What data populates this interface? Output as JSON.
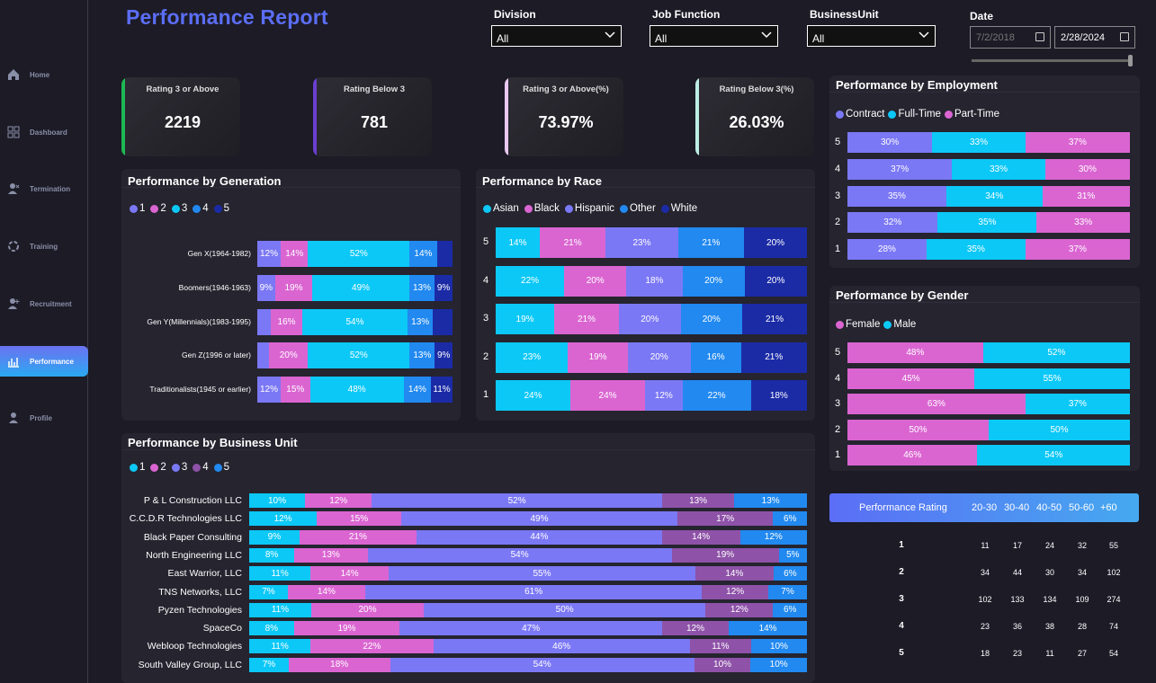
{
  "title": "Performance Report",
  "nav": [
    {
      "label": "Home",
      "icon": "home-icon",
      "active": false
    },
    {
      "label": "Dashboard",
      "icon": "dashboard-icon",
      "active": false
    },
    {
      "label": "Termination",
      "icon": "user-remove-icon",
      "active": false
    },
    {
      "label": "Training",
      "icon": "training-icon",
      "active": false
    },
    {
      "label": "Recruitment",
      "icon": "user-add-icon",
      "active": false
    },
    {
      "label": "Performance",
      "icon": "performance-chart-icon",
      "active": true
    },
    {
      "label": "Profile",
      "icon": "profile-icon",
      "active": false
    }
  ],
  "filters": {
    "division": {
      "label": "Division",
      "value": "All"
    },
    "job_function": {
      "label": "Job Function",
      "value": "All"
    },
    "business_unit": {
      "label": "BusinessUnit",
      "value": "All"
    },
    "date": {
      "label": "Date",
      "start": "7/2/2018",
      "end": "2/28/2024"
    }
  },
  "kpis": [
    {
      "title": "Rating 3 or Above",
      "value": "2219",
      "color": "#1db954"
    },
    {
      "title": "Rating Below 3",
      "value": "781",
      "color": "#6a3fd1"
    },
    {
      "title": "Rating 3 or Above(%)",
      "value": "73.97%",
      "color": "#e8c8f0"
    },
    {
      "title": "Rating Below 3(%)",
      "value": "26.03%",
      "color": "#bdeee4"
    }
  ],
  "colors": {
    "c1": "#7b78f5",
    "c2": "#da65d1",
    "c3": "#0cc8f7",
    "c4": "#2189f0",
    "c5": "#1b2ba6",
    "purple": "#8e52a8"
  },
  "generation": {
    "title": "Performance by Generation",
    "legend": [
      "1",
      "2",
      "3",
      "4",
      "5"
    ],
    "rows": [
      {
        "label": "Gen X(1964-1982)",
        "values": [
          12,
          14,
          52,
          14,
          8
        ],
        "labels": [
          "12%",
          "14%",
          "52%",
          "14%",
          ""
        ]
      },
      {
        "label": "Boomers(1946-1963)",
        "values": [
          9,
          19,
          49,
          13,
          9
        ],
        "labels": [
          "9%",
          "19%",
          "49%",
          "13%",
          "9%"
        ]
      },
      {
        "label": "Gen Y(Millennials)(1983-1995)",
        "values": [
          7,
          16,
          54,
          13,
          10
        ],
        "labels": [
          "",
          "16%",
          "54%",
          "13%",
          ""
        ]
      },
      {
        "label": "Gen Z(1996 or later)",
        "values": [
          6,
          20,
          52,
          13,
          9
        ],
        "labels": [
          "",
          "20%",
          "52%",
          "13%",
          "9%"
        ]
      },
      {
        "label": "Traditionalists(1945 or earlier)",
        "values": [
          12,
          15,
          48,
          14,
          11
        ],
        "labels": [
          "12%",
          "15%",
          "48%",
          "14%",
          "11%"
        ]
      }
    ]
  },
  "race": {
    "title": "Performance by Race",
    "legend": [
      "Asian",
      "Black",
      "Hispanic",
      "Other",
      "White"
    ],
    "rows": [
      {
        "label": "5",
        "values": [
          14,
          21,
          23,
          21,
          20
        ],
        "labels": [
          "14%",
          "21%",
          "23%",
          "21%",
          "20%"
        ]
      },
      {
        "label": "4",
        "values": [
          22,
          20,
          18,
          20,
          20
        ],
        "labels": [
          "22%",
          "20%",
          "18%",
          "20%",
          "20%"
        ]
      },
      {
        "label": "3",
        "values": [
          19,
          21,
          20,
          20,
          21
        ],
        "labels": [
          "19%",
          "21%",
          "20%",
          "20%",
          "21%"
        ]
      },
      {
        "label": "2",
        "values": [
          23,
          19,
          20,
          16,
          21
        ],
        "labels": [
          "23%",
          "19%",
          "20%",
          "16%",
          "21%"
        ]
      },
      {
        "label": "1",
        "values": [
          24,
          24,
          12,
          22,
          18
        ],
        "labels": [
          "24%",
          "24%",
          "12%",
          "22%",
          "18%"
        ]
      }
    ]
  },
  "employment": {
    "title": "Performance by Employment",
    "legend": [
      "Contract",
      "Full-Time",
      "Part-Time"
    ],
    "rows": [
      {
        "label": "5",
        "values": [
          30,
          33,
          37
        ],
        "labels": [
          "30%",
          "33%",
          "37%"
        ]
      },
      {
        "label": "4",
        "values": [
          37,
          33,
          30
        ],
        "labels": [
          "37%",
          "33%",
          "30%"
        ]
      },
      {
        "label": "3",
        "values": [
          35,
          34,
          31
        ],
        "labels": [
          "35%",
          "34%",
          "31%"
        ]
      },
      {
        "label": "2",
        "values": [
          32,
          35,
          33
        ],
        "labels": [
          "32%",
          "35%",
          "33%"
        ]
      },
      {
        "label": "1",
        "values": [
          28,
          35,
          37
        ],
        "labels": [
          "28%",
          "35%",
          "37%"
        ]
      }
    ]
  },
  "gender": {
    "title": "Performance by Gender",
    "legend": [
      "Female",
      "Male"
    ],
    "rows": [
      {
        "label": "5",
        "values": [
          48,
          52
        ],
        "labels": [
          "48%",
          "52%"
        ]
      },
      {
        "label": "4",
        "values": [
          45,
          55
        ],
        "labels": [
          "45%",
          "55%"
        ]
      },
      {
        "label": "3",
        "values": [
          63,
          37
        ],
        "labels": [
          "63%",
          "37%"
        ]
      },
      {
        "label": "2",
        "values": [
          50,
          50
        ],
        "labels": [
          "50%",
          "50%"
        ]
      },
      {
        "label": "1",
        "values": [
          46,
          54
        ],
        "labels": [
          "46%",
          "54%"
        ]
      }
    ]
  },
  "business_unit": {
    "title": "Performance by Business Unit",
    "legend": [
      "1",
      "2",
      "3",
      "4",
      "5"
    ],
    "rows": [
      {
        "label": "P & L Construction LLC",
        "values": [
          10,
          12,
          52,
          13,
          13
        ],
        "labels": [
          "10%",
          "12%",
          "52%",
          "13%",
          "13%"
        ]
      },
      {
        "label": "C.C.D.R Technologies LLC",
        "values": [
          12,
          15,
          49,
          17,
          6
        ],
        "labels": [
          "12%",
          "15%",
          "49%",
          "17%",
          "6%"
        ]
      },
      {
        "label": "Black Paper Consulting",
        "values": [
          9,
          21,
          44,
          14,
          12
        ],
        "labels": [
          "9%",
          "21%",
          "44%",
          "14%",
          "12%"
        ]
      },
      {
        "label": "North Engineering LLC",
        "values": [
          8,
          13,
          54,
          19,
          5
        ],
        "labels": [
          "8%",
          "13%",
          "54%",
          "19%",
          "5%"
        ]
      },
      {
        "label": "East Warrior, LLC",
        "values": [
          11,
          14,
          55,
          14,
          6
        ],
        "labels": [
          "11%",
          "14%",
          "55%",
          "14%",
          "6%"
        ]
      },
      {
        "label": "TNS Networks, LLC",
        "values": [
          7,
          14,
          61,
          12,
          7
        ],
        "labels": [
          "7%",
          "14%",
          "61%",
          "12%",
          "7%"
        ]
      },
      {
        "label": "Pyzen Technologies",
        "values": [
          11,
          20,
          50,
          12,
          6
        ],
        "labels": [
          "11%",
          "20%",
          "50%",
          "12%",
          "6%"
        ]
      },
      {
        "label": "SpaceCo",
        "values": [
          8,
          19,
          47,
          12,
          14
        ],
        "labels": [
          "8%",
          "19%",
          "47%",
          "12%",
          "14%"
        ]
      },
      {
        "label": "Webloop Technologies",
        "values": [
          11,
          22,
          46,
          11,
          10
        ],
        "labels": [
          "11%",
          "22%",
          "46%",
          "11%",
          "10%"
        ]
      },
      {
        "label": "South Valley Group, LLC",
        "values": [
          7,
          18,
          54,
          10,
          10
        ],
        "labels": [
          "7%",
          "18%",
          "54%",
          "10%",
          "10%"
        ]
      }
    ]
  },
  "rating_table": {
    "header": "Performance Rating",
    "columns": [
      "20-30",
      "30-40",
      "40-50",
      "50-60",
      "+60"
    ],
    "rows": [
      {
        "rating": "1",
        "values": [
          "11",
          "17",
          "24",
          "32",
          "55"
        ]
      },
      {
        "rating": "2",
        "values": [
          "34",
          "44",
          "30",
          "34",
          "102"
        ]
      },
      {
        "rating": "3",
        "values": [
          "102",
          "133",
          "134",
          "109",
          "274"
        ]
      },
      {
        "rating": "4",
        "values": [
          "23",
          "36",
          "38",
          "28",
          "74"
        ]
      },
      {
        "rating": "5",
        "values": [
          "18",
          "23",
          "11",
          "27",
          "54"
        ]
      }
    ]
  }
}
